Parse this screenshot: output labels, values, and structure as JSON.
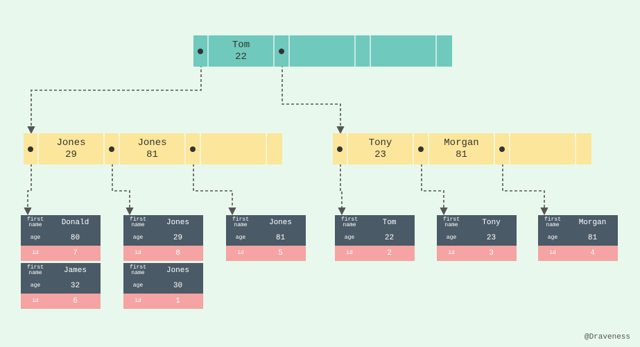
{
  "chart_data": {
    "type": "b+tree",
    "root": {
      "keys": [
        {
          "name": "Tom",
          "value": 22
        }
      ],
      "empty_slots": 2,
      "color": "teal"
    },
    "internal": [
      {
        "keys": [
          {
            "name": "Jones",
            "value": 29
          },
          {
            "name": "Jones",
            "value": 81
          }
        ],
        "empty_slots": 1,
        "color": "yellow"
      },
      {
        "keys": [
          {
            "name": "Tony",
            "value": 23
          },
          {
            "name": "Morgan",
            "value": 81
          }
        ],
        "empty_slots": 1,
        "color": "yellow"
      }
    ],
    "leaves": [
      {
        "group": 0,
        "records": [
          {
            "first_name": "Donald",
            "age": 80,
            "id": 7
          },
          {
            "first_name": "James",
            "age": 32,
            "id": 6
          }
        ]
      },
      {
        "group": 0,
        "records": [
          {
            "first_name": "Jones",
            "age": 29,
            "id": 8
          },
          {
            "first_name": "Jones",
            "age": 30,
            "id": 1
          }
        ]
      },
      {
        "group": 0,
        "records": [
          {
            "first_name": "Jones",
            "age": 81,
            "id": 5
          }
        ]
      },
      {
        "group": 1,
        "records": [
          {
            "first_name": "Tom",
            "age": 22,
            "id": 2
          }
        ]
      },
      {
        "group": 1,
        "records": [
          {
            "first_name": "Tony",
            "age": 23,
            "id": 3
          }
        ]
      },
      {
        "group": 1,
        "records": [
          {
            "first_name": "Morgan",
            "age": 81,
            "id": 4
          }
        ]
      }
    ]
  },
  "labels": {
    "first_name": "first name",
    "age": "age",
    "id": "id"
  },
  "credit": "@Draveness"
}
